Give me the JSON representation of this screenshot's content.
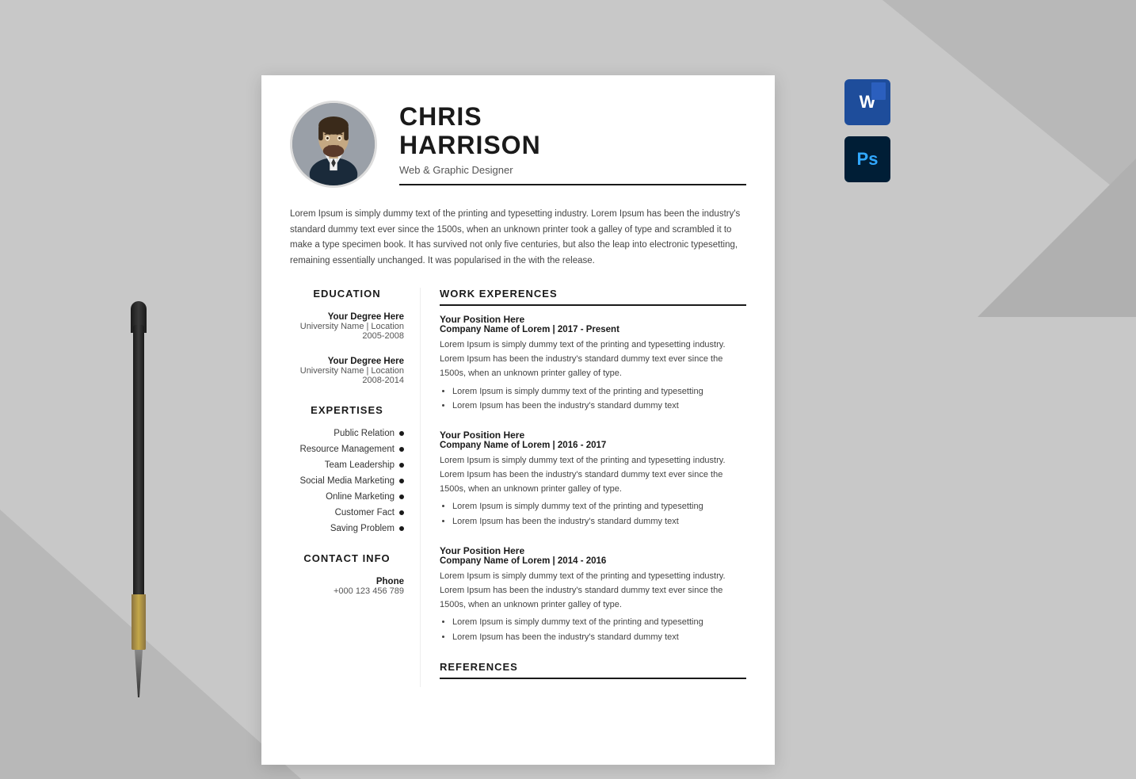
{
  "background": {
    "color": "#c8c8c8"
  },
  "app_icons": {
    "word_label": "W",
    "ps_label": "Ps"
  },
  "resume": {
    "name_first": "CHRIS",
    "name_last": "HARRISON",
    "job_title": "Web & Graphic Designer",
    "bio": "Lorem Ipsum is simply dummy text of the printing and typesetting industry. Lorem Ipsum has been the industry's standard dummy text ever since the 1500s, when an unknown printer took a galley of type and scrambled it to make a type specimen book. It has survived not only five centuries, but also the leap into electronic typesetting, remaining essentially unchanged. It was popularised in the with the release.",
    "education_title": "EDUCATION",
    "education": [
      {
        "degree": "Your Degree Here",
        "school": "University Name | Location",
        "years": "2005-2008"
      },
      {
        "degree": "Your Degree Here",
        "school": "University Name | Location",
        "years": "2008-2014"
      }
    ],
    "expertises_title": "EXPERTISES",
    "expertises": [
      "Public Relation",
      "Resource Management",
      "Team Leadership",
      "Social Media Marketing",
      "Online Marketing",
      "Customer Fact",
      "Saving Problem"
    ],
    "contact_title": "CONTACT INFO",
    "contact": {
      "phone_label": "Phone",
      "phone_value": "+000 123 456 789"
    },
    "work_title": "WORK EXPERENCES",
    "work_experiences": [
      {
        "position": "Your Position Here",
        "company": "Company Name of Lorem | 2017 - Present",
        "description": "Lorem Ipsum is simply dummy text of the printing and typesetting industry. Lorem Ipsum has been the industry's standard dummy text ever since the 1500s, when an unknown printer galley of type.",
        "bullets": [
          "Lorem Ipsum is simply dummy text of the printing and typesetting",
          "Lorem Ipsum has been the industry's standard dummy text"
        ]
      },
      {
        "position": "Your Position Here",
        "company": "Company Name of Lorem | 2016 - 2017",
        "description": "Lorem Ipsum is simply dummy text of the printing and typesetting industry. Lorem Ipsum has been the industry's standard dummy text ever since the 1500s, when an unknown printer galley of type.",
        "bullets": [
          "Lorem Ipsum is simply dummy text of the printing and typesetting",
          "Lorem Ipsum has been the industry's standard dummy text"
        ]
      },
      {
        "position": "Your Position Here",
        "company": "Company Name of Lorem | 2014 - 2016",
        "description": "Lorem Ipsum is simply dummy text of the printing and typesetting industry. Lorem Ipsum has been the industry's standard dummy text ever since the 1500s, when an unknown printer galley of type.",
        "bullets": [
          "Lorem Ipsum is simply dummy text of the printing and typesetting",
          "Lorem Ipsum has been the industry's standard dummy text"
        ]
      }
    ],
    "references_title": "REFERENCES"
  }
}
